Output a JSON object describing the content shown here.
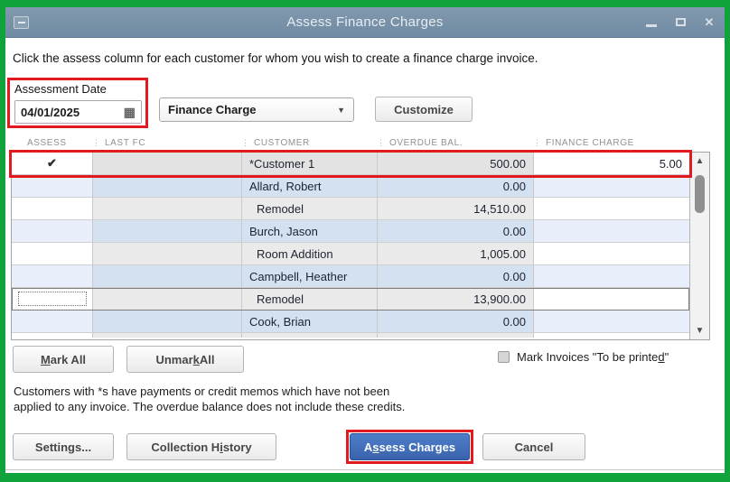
{
  "window": {
    "title": "Assess Finance Charges"
  },
  "instruction": "Click the assess column for each customer for whom you wish to create a finance charge invoice.",
  "form": {
    "assessment_date_label": "Assessment Date",
    "assessment_date_value": "04/01/2025",
    "charge_item_value": "Finance Charge",
    "customize_button": "Customize"
  },
  "table": {
    "headers": [
      "ASSESS",
      "LAST FC",
      "CUSTOMER",
      "OVERDUE BAL.",
      "FINANCE CHARGE"
    ],
    "rows": [
      {
        "assess": "✔",
        "last_fc": "",
        "customer": "*Customer 1",
        "overdue_bal": "500.00",
        "finance_charge": "5.00"
      },
      {
        "assess": "",
        "last_fc": "",
        "customer": "Allard, Robert",
        "overdue_bal": "0.00",
        "finance_charge": ""
      },
      {
        "assess": "",
        "last_fc": "",
        "customer": "Remodel",
        "overdue_bal": "14,510.00",
        "finance_charge": ""
      },
      {
        "assess": "",
        "last_fc": "",
        "customer": "Burch, Jason",
        "overdue_bal": "0.00",
        "finance_charge": ""
      },
      {
        "assess": "",
        "last_fc": "",
        "customer": "Room Addition",
        "overdue_bal": "1,005.00",
        "finance_charge": ""
      },
      {
        "assess": "",
        "last_fc": "",
        "customer": "Campbell, Heather",
        "overdue_bal": "0.00",
        "finance_charge": ""
      },
      {
        "assess": "",
        "last_fc": "",
        "customer": "Remodel",
        "overdue_bal": "13,900.00",
        "finance_charge": ""
      },
      {
        "assess": "",
        "last_fc": "",
        "customer": "Cook, Brian",
        "overdue_bal": "0.00",
        "finance_charge": ""
      }
    ]
  },
  "buttons": {
    "mark_all": {
      "pre": "",
      "key": "M",
      "post": "ark All"
    },
    "unmark_all": {
      "pre": "Unmar",
      "key": "k",
      "post": " All"
    },
    "settings": {
      "pre": "Settin",
      "key": "g",
      "post": "s..."
    },
    "collection_history": {
      "pre": "Collection H",
      "key": "i",
      "post": "story"
    },
    "assess_charges": {
      "pre": "A",
      "key": "s",
      "post": "sess Charges"
    },
    "cancel": {
      "pre": "Cancel",
      "key": "",
      "post": ""
    }
  },
  "checkbox": {
    "pre": "Mark Invoices \"To be printe",
    "key": "d",
    "post": "\"",
    "checked": false
  },
  "note": {
    "line1": "Customers with *s have payments or credit memos which have not been",
    "line2": "applied to any invoice.  The overdue balance does not include these credits."
  },
  "icons": {
    "calendar": "▦",
    "dropdown_arrow": "▼",
    "scroll_up": "▲",
    "scroll_down": "▼",
    "close": "✕",
    "col_separator": "⋮"
  },
  "colors": {
    "frame_green": "#10a33c",
    "highlight_red": "#e01a1f",
    "primary_button_blue": "#3f6cb5",
    "titlebar_blue": "#7691a8",
    "row_alt_blue": "#d4e1f1"
  }
}
